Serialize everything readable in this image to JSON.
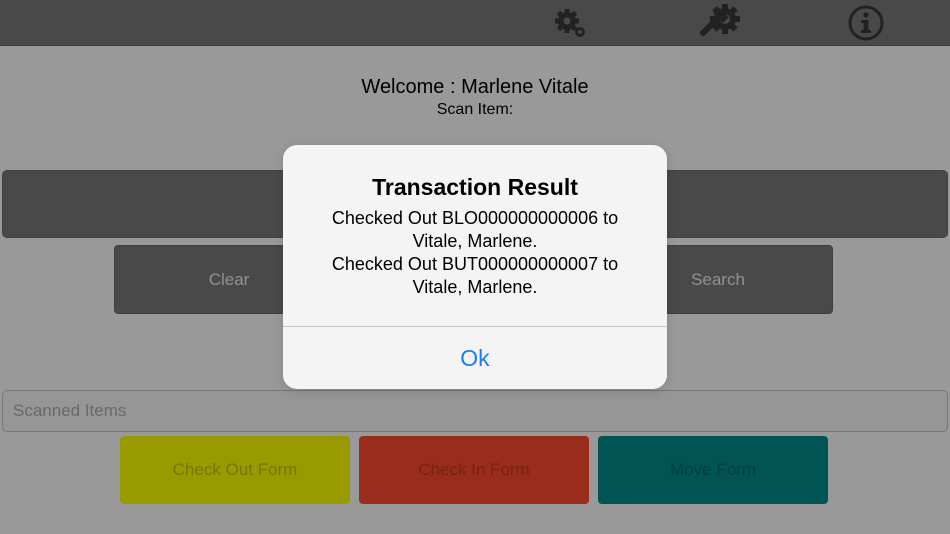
{
  "header": {
    "icons": [
      "settings-gear-icon",
      "wrench-gear-icon",
      "info-icon"
    ],
    "bar_color": "#7a7a7a"
  },
  "main": {
    "welcome": "Welcome : Marlene Vitale",
    "scan_label": "Scan Item:",
    "clear_label": "Clear",
    "search_label": "Search",
    "scanned_placeholder": "Scanned Items",
    "forms": [
      {
        "label": "Check Out Form",
        "color": "#ffff00"
      },
      {
        "label": "Check In Form",
        "color": "#ff4a2e"
      },
      {
        "label": "Move Form",
        "color": "#008c8c"
      }
    ]
  },
  "dialog": {
    "title": "Transaction Result",
    "message_lines": [
      "Checked Out BLO000000000006 to",
      "Vitale, Marlene.",
      "Checked Out BUT000000000007 to",
      "Vitale, Marlene."
    ],
    "ok_label": "Ok",
    "accent": "#1a7cf5"
  }
}
